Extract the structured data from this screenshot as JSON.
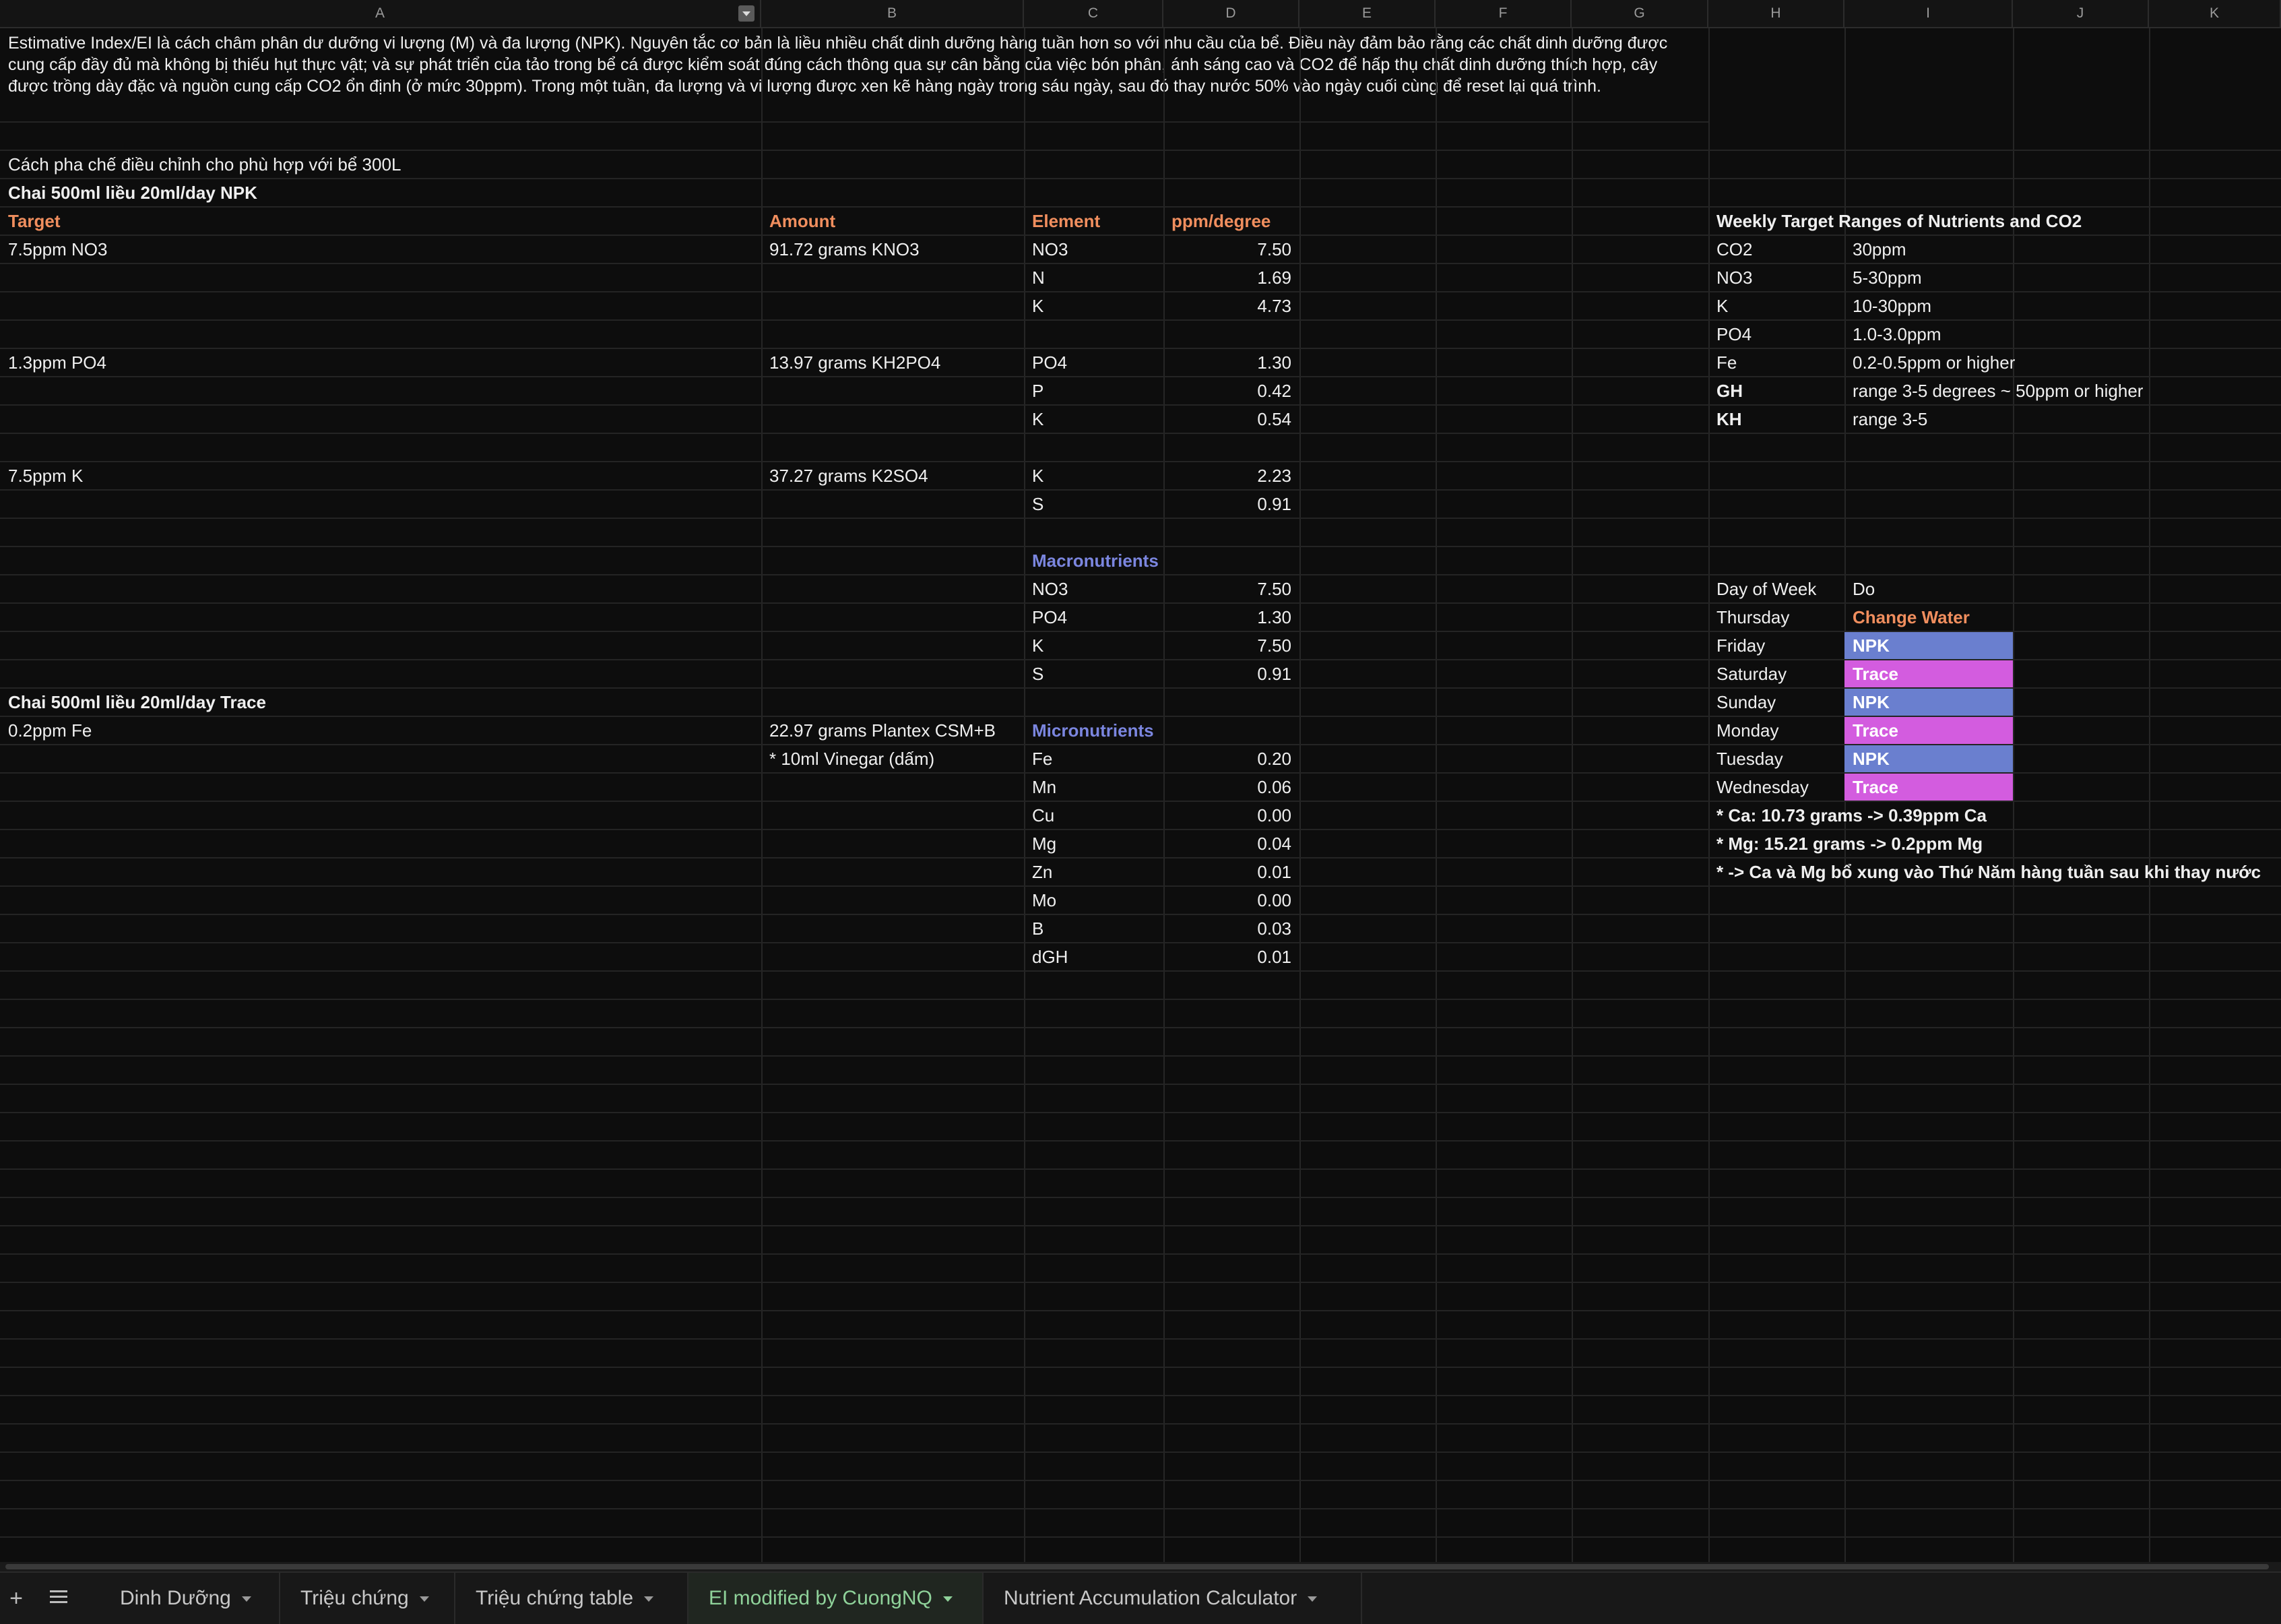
{
  "columns": [
    "A",
    "B",
    "C",
    "D",
    "E",
    "F",
    "G",
    "H",
    "I",
    "J",
    "K"
  ],
  "intro_text": "Estimative Index/EI là cách châm phân dư dưỡng vi lượng (M) và đa lượng (NPK). Nguyên tắc cơ bản là liều nhiều chất dinh dưỡng hàng tuần hơn so với nhu cầu của bể. Điều này đảm bảo rằng các chất dinh dưỡng được cung cấp đầy đủ mà không bị thiếu hụt thực vật; và sự phát triển của tảo trong bể cá được kiểm soát đúng cách thông qua sự cân bằng của việc bón phân, ánh sáng cao và CO2 để hấp thụ chất dinh dưỡng thích hợp, cây được trồng dày đặc và nguồn cung cấp CO2 ổn định (ở mức 30ppm). Trong một tuần, đa lượng và vi lượng được xen kẽ hàng ngày trong sáu ngày, sau đó thay nước 50% vào ngày cuối cùng để reset lại quá trình.",
  "recipe_note": "Cách pha chế điều chỉnh cho phù hợp với bể 300L",
  "npk_header": "Chai 500ml liều 20ml/day NPK",
  "headers": {
    "target": "Target",
    "amount": "Amount",
    "element": "Element",
    "ppm": "ppm/degree"
  },
  "npk": {
    "no3_target": "7.5ppm NO3",
    "no3_amount": "91.72 grams KNO3",
    "no3_rows": [
      {
        "el": "NO3",
        "val": "7.50"
      },
      {
        "el": "N",
        "val": "1.69"
      },
      {
        "el": "K",
        "val": "4.73"
      }
    ],
    "po4_target": "1.3ppm PO4",
    "po4_amount": "13.97 grams KH2PO4",
    "po4_rows": [
      {
        "el": "PO4",
        "val": "1.30"
      },
      {
        "el": "P",
        "val": "0.42"
      },
      {
        "el": "K",
        "val": "0.54"
      }
    ],
    "k_target": "7.5ppm K",
    "k_amount": "37.27 grams K2SO4",
    "k_rows": [
      {
        "el": "K",
        "val": "2.23"
      },
      {
        "el": "S",
        "val": "0.91"
      }
    ]
  },
  "macro": {
    "label": "Macronutrients",
    "rows": [
      {
        "el": "NO3",
        "val": "7.50"
      },
      {
        "el": "PO4",
        "val": "1.30"
      },
      {
        "el": "K",
        "val": "7.50"
      },
      {
        "el": "S",
        "val": "0.91"
      }
    ]
  },
  "trace_header": "Chai 500ml liều 20ml/day Trace",
  "trace": {
    "target": "0.2ppm Fe",
    "amount": "22.97 grams Plantex CSM+B",
    "amount_note": "* 10ml Vinegar (dấm)",
    "label": "Micronutrients",
    "rows": [
      {
        "el": "Fe",
        "val": "0.20"
      },
      {
        "el": "Mn",
        "val": "0.06"
      },
      {
        "el": "Cu",
        "val": "0.00"
      },
      {
        "el": "Mg",
        "val": "0.04"
      },
      {
        "el": "Zn",
        "val": "0.01"
      },
      {
        "el": "Mo",
        "val": "0.00"
      },
      {
        "el": "B",
        "val": "0.03"
      },
      {
        "el": "dGH",
        "val": "0.01"
      }
    ]
  },
  "weekly": {
    "title": "Weekly Target Ranges of Nutrients and CO2",
    "rows": [
      {
        "k": "CO2",
        "v": "30ppm",
        "bold": false
      },
      {
        "k": "NO3",
        "v": "5-30ppm",
        "bold": false
      },
      {
        "k": "K",
        "v": "10-30ppm",
        "bold": false
      },
      {
        "k": "PO4",
        "v": "1.0-3.0ppm",
        "bold": false
      },
      {
        "k": "Fe",
        "v": "0.2-0.5ppm or higher",
        "bold": false
      },
      {
        "k": "GH",
        "v": "range 3-5 degrees ~ 50ppm or higher",
        "bold": true
      },
      {
        "k": "KH",
        "v": "range 3-5",
        "bold": true
      }
    ]
  },
  "schedule": {
    "header_day": "Day of Week",
    "header_do": "Do",
    "rows": [
      {
        "day": "Thursday",
        "do": "Change Water",
        "type": "water"
      },
      {
        "day": "Friday",
        "do": "NPK",
        "type": "npk"
      },
      {
        "day": "Saturday",
        "do": "Trace",
        "type": "trace"
      },
      {
        "day": "Sunday",
        "do": "NPK",
        "type": "npk"
      },
      {
        "day": "Monday",
        "do": "Trace",
        "type": "trace"
      },
      {
        "day": "Tuesday",
        "do": "NPK",
        "type": "npk"
      },
      {
        "day": "Wednesday",
        "do": "Trace",
        "type": "trace"
      }
    ],
    "notes": [
      "* Ca: 10.73 grams -> 0.39ppm Ca",
      "* Mg: 15.21 grams -> 0.2ppm Mg",
      "* -> Ca và Mg bổ xung vào Thứ Năm hàng tuần sau khi thay nước"
    ]
  },
  "tabs": [
    {
      "label": "Dinh Dưỡng",
      "active": false
    },
    {
      "label": "Triệu chứng",
      "active": false
    },
    {
      "label": "Triệu chứng table",
      "active": false
    },
    {
      "label": "EI modified by CuongNQ",
      "active": true
    },
    {
      "label": "Nutrient Accumulation Calculator",
      "active": false
    }
  ],
  "colors": {
    "orange": "#f08e5e",
    "blue": "#7b86df",
    "npk_fill": "#6a7fcf",
    "trace_fill": "#d35cdf",
    "active_tab": "#8fd29a"
  }
}
